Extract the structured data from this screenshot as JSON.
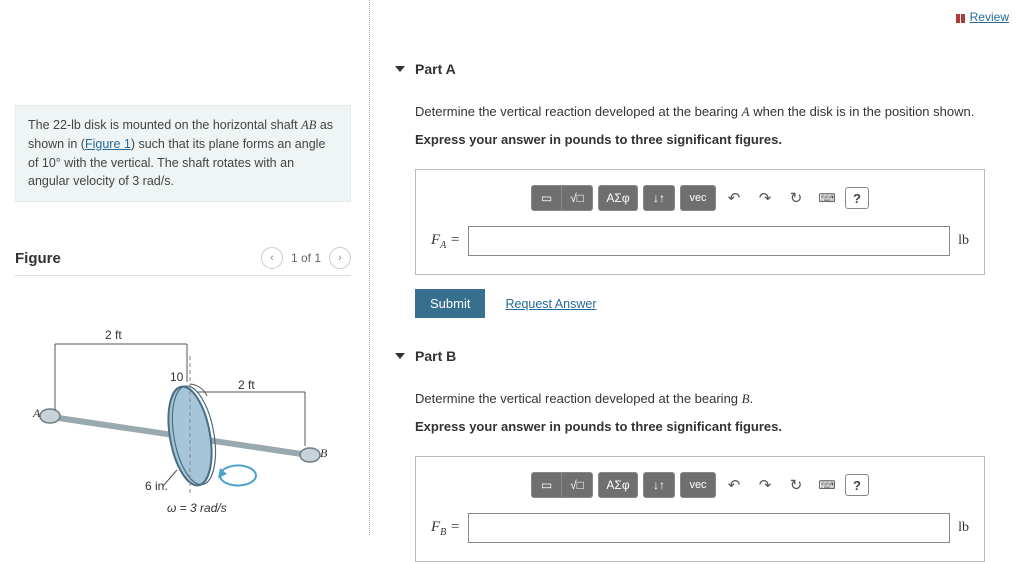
{
  "topbar": {
    "review": "Review"
  },
  "problem": {
    "text_pre": "The 22-",
    "unit_lb": "lb",
    "text_mid1": " disk is mounted on the horizontal shaft ",
    "shaft": "AB",
    "text_mid2": " as shown in (",
    "fig_link": "Figure 1",
    "text_mid3": ") such that its plane forms an angle of 10° with the vertical. The shaft rotates with an angular velocity of 3 ",
    "unit_rads": "rad/s",
    "text_end": "."
  },
  "figure": {
    "title": "Figure",
    "nav_prev": "‹",
    "nav_count": "1 of 1",
    "nav_next": "›",
    "labels": {
      "len_left": "2 ft",
      "len_right": "2 ft",
      "angle": "10",
      "A": "A",
      "B": "B",
      "radius": "6 in.",
      "omega": "ω = 3 rad/s"
    }
  },
  "partA": {
    "title": "Part A",
    "prompt": "Determine the vertical reaction developed at the bearing ",
    "var": "A",
    "prompt_tail": " when the disk is in the position shown.",
    "instruction": "Express your answer in pounds to three significant figures.",
    "label_base": "F",
    "label_sub": "A",
    "equals": " = ",
    "unit": "lb",
    "submit": "Submit",
    "request": "Request Answer"
  },
  "partB": {
    "title": "Part B",
    "prompt": "Determine the vertical reaction developed at the bearing ",
    "var": "B",
    "prompt_tail": ".",
    "instruction": "Express your answer in pounds to three significant figures.",
    "label_base": "F",
    "label_sub": "B",
    "equals": " = ",
    "unit": "lb"
  },
  "toolbar": {
    "tpl": "▭",
    "sqrt": "√□",
    "greek": "ΑΣφ",
    "updown": "↓↑",
    "vec": "vec",
    "undo": "↶",
    "redo": "↷",
    "reset": "↻",
    "kbd": "⌨",
    "help": "?"
  }
}
